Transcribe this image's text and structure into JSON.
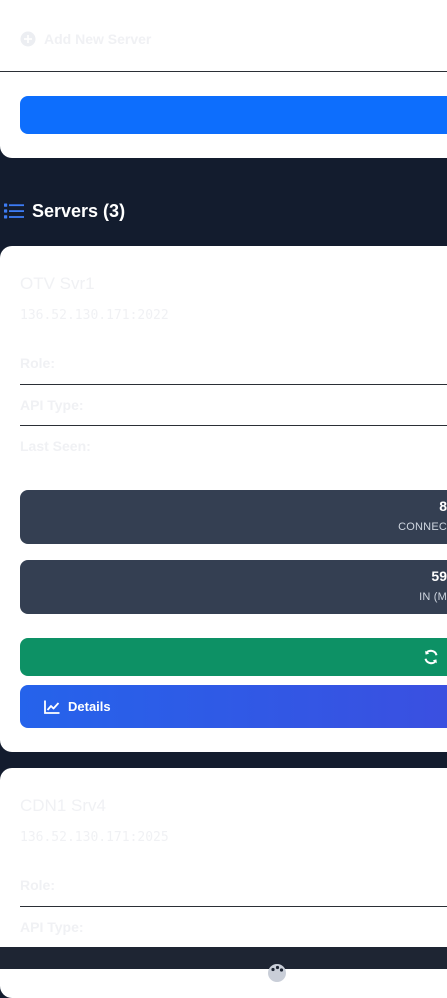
{
  "add_panel": {
    "title": "Add New Server"
  },
  "servers_header": {
    "title": "Servers (3)"
  },
  "servers": [
    {
      "name": "OTV Svr1",
      "address": "136.52.130.171:2022",
      "fields": {
        "role_label": "Role:",
        "api_label": "API Type:",
        "last_seen_label": "Last Seen:"
      },
      "stats": [
        {
          "value": "8",
          "label": "CONNEC"
        },
        {
          "value": "59",
          "label": "IN (M"
        }
      ],
      "details_label": "Details"
    },
    {
      "name": "CDN1 Srv4",
      "address": "136.52.130.171:2025",
      "fields": {
        "role_label": "Role:",
        "api_label": "API Type:"
      }
    }
  ],
  "colors": {
    "background": "#131c2e",
    "primary": "#0d6efd",
    "success": "#0d9165",
    "stat_bg": "#343f52",
    "details_gradient_start": "#2563eb",
    "details_gradient_end": "#3b4fe0"
  }
}
